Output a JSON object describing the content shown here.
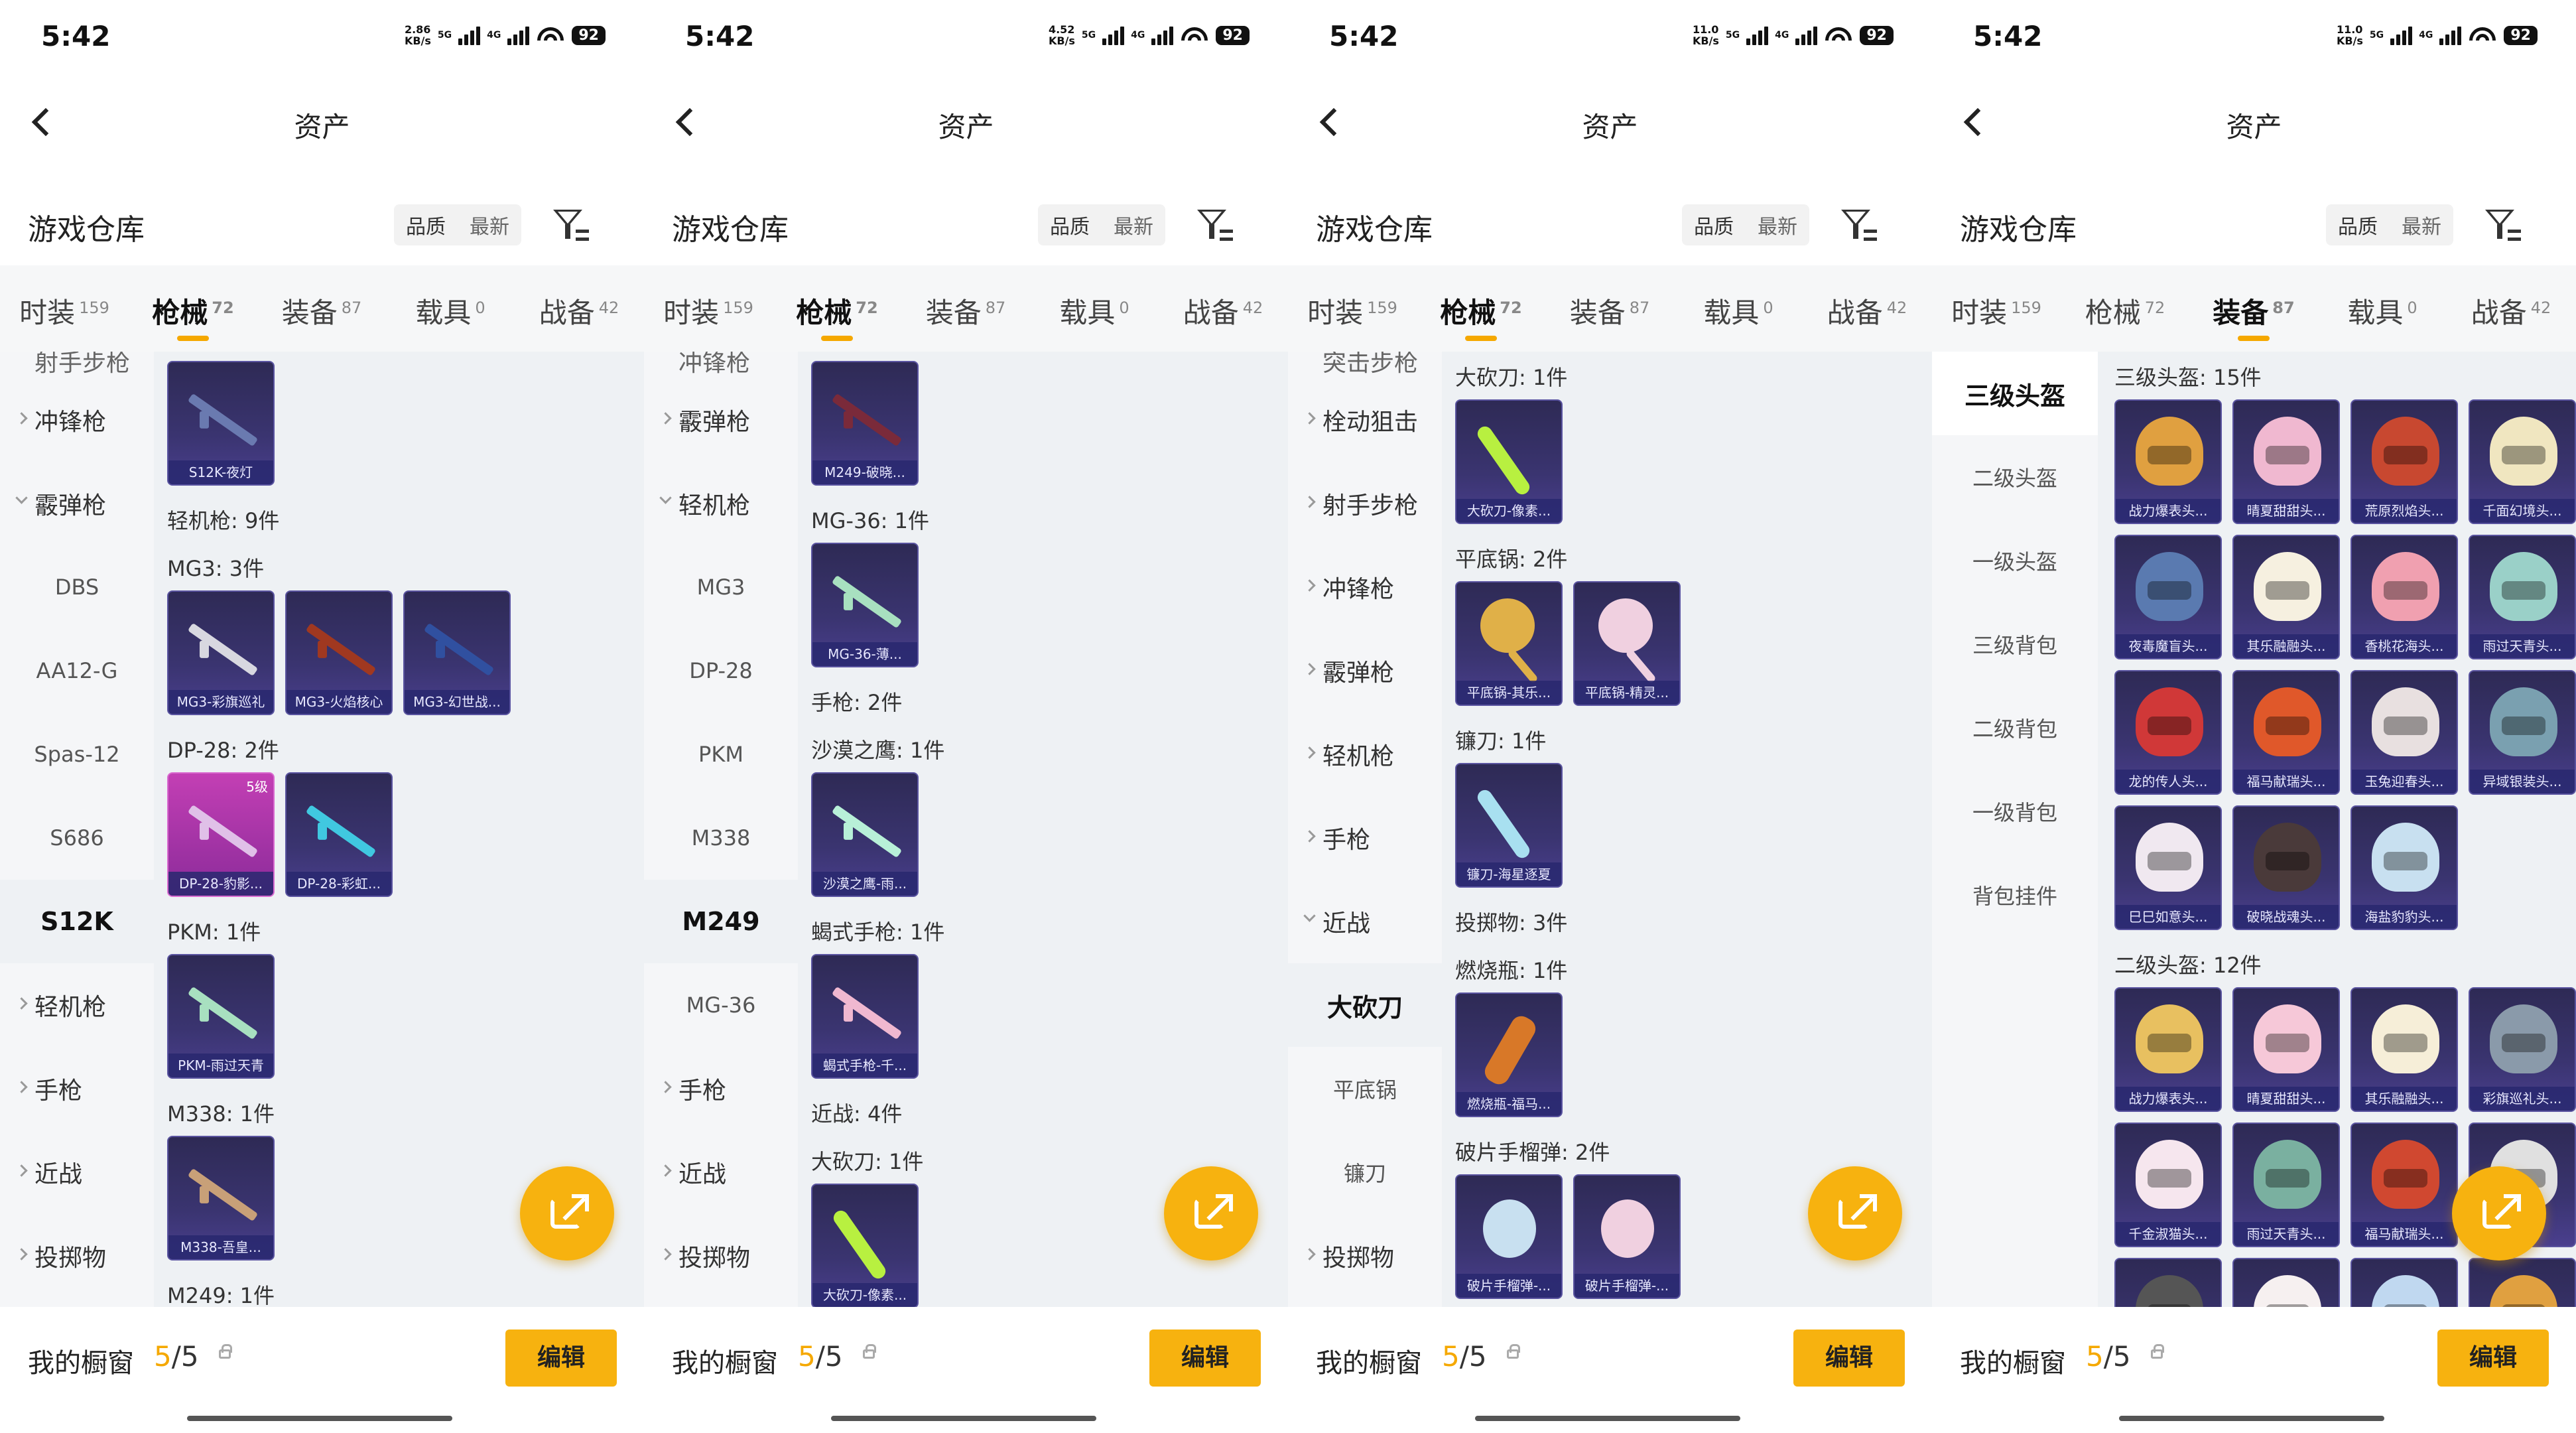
{
  "panels": [
    {
      "status": {
        "time": "5:42",
        "speed": "2.86",
        "speed_unit": "KB/s",
        "net": "5G",
        "net2": "4G",
        "battery": "92"
      },
      "nav": {
        "title": "资产"
      },
      "header": {
        "title": "游戏仓库",
        "sort1": "品质",
        "sort2": "最新"
      },
      "tabs": [
        {
          "label": "时装",
          "count": "159"
        },
        {
          "label": "枪械",
          "count": "72"
        },
        {
          "label": "装备",
          "count": "87"
        },
        {
          "label": "载具",
          "count": "0"
        },
        {
          "label": "战备",
          "count": "42"
        }
      ],
      "side": [
        "射手步枪",
        "冲锋枪",
        "霰弹枪",
        "DBS",
        "AA12-G",
        "Spas-12",
        "S686",
        "S12K",
        "轻机枪",
        "手枪",
        "近战",
        "投掷物"
      ],
      "sections": [
        {
          "title": "",
          "items": [
            {
              "name": "S12K-夜灯"
            }
          ]
        },
        {
          "title": "轻机枪: 9件",
          "items": []
        },
        {
          "title": "MG3: 3件",
          "items": [
            {
              "name": "MG3-彩旗巡礼"
            },
            {
              "name": "MG3-火焰核心"
            },
            {
              "name": "MG3-幻世战..."
            }
          ]
        },
        {
          "title": "DP-28: 2件",
          "items": [
            {
              "name": "DP-28-豹影...",
              "badge": "5级"
            },
            {
              "name": "DP-28-彩虹..."
            }
          ]
        },
        {
          "title": "PKM: 1件",
          "items": [
            {
              "name": "PKM-雨过天青"
            }
          ]
        },
        {
          "title": "M338: 1件",
          "items": [
            {
              "name": "M338-吾皇..."
            }
          ]
        },
        {
          "title": "M249: 1件",
          "items": []
        }
      ],
      "footer": {
        "title": "我的橱窗",
        "count_hl": "5",
        "count_rest": "/5",
        "edit": "编辑"
      }
    },
    {
      "status": {
        "time": "5:42",
        "speed": "4.52",
        "speed_unit": "KB/s",
        "net": "5G",
        "net2": "4G",
        "battery": "92"
      },
      "nav": {
        "title": "资产"
      },
      "header": {
        "title": "游戏仓库",
        "sort1": "品质",
        "sort2": "最新"
      },
      "tabs": [
        {
          "label": "时装",
          "count": "159"
        },
        {
          "label": "枪械",
          "count": "72"
        },
        {
          "label": "装备",
          "count": "87"
        },
        {
          "label": "载具",
          "count": "0"
        },
        {
          "label": "战备",
          "count": "42"
        }
      ],
      "side": [
        "冲锋枪",
        "霰弹枪",
        "轻机枪",
        "MG3",
        "DP-28",
        "PKM",
        "M338",
        "M249",
        "MG-36",
        "手枪",
        "近战",
        "投掷物"
      ],
      "sections": [
        {
          "title": "",
          "items": [
            {
              "name": "M249-破晓..."
            }
          ]
        },
        {
          "title": "MG-36: 1件",
          "items": [
            {
              "name": "MG-36-薄..."
            }
          ]
        },
        {
          "title": "手枪: 2件",
          "items": []
        },
        {
          "title": "沙漠之鹰: 1件",
          "items": [
            {
              "name": "沙漠之鹰-雨..."
            }
          ]
        },
        {
          "title": "蝎式手枪: 1件",
          "items": [
            {
              "name": "蝎式手枪-千..."
            }
          ]
        },
        {
          "title": "近战: 4件",
          "items": []
        },
        {
          "title": "大砍刀: 1件",
          "items": [
            {
              "name": "大砍刀-像素..."
            }
          ]
        }
      ],
      "footer": {
        "title": "我的橱窗",
        "count_hl": "5",
        "count_rest": "/5",
        "edit": "编辑"
      }
    },
    {
      "status": {
        "time": "5:42",
        "speed": "11.0",
        "speed_unit": "KB/s",
        "net": "5G",
        "net2": "4G",
        "battery": "92"
      },
      "nav": {
        "title": "资产"
      },
      "header": {
        "title": "游戏仓库",
        "sort1": "品质",
        "sort2": "最新"
      },
      "tabs": [
        {
          "label": "时装",
          "count": "159"
        },
        {
          "label": "枪械",
          "count": "72"
        },
        {
          "label": "装备",
          "count": "87"
        },
        {
          "label": "载具",
          "count": "0"
        },
        {
          "label": "战备",
          "count": "42"
        }
      ],
      "side": [
        "突击步枪",
        "栓动狙击",
        "射手步枪",
        "冲锋枪",
        "霰弹枪",
        "轻机枪",
        "手枪",
        "近战",
        "大砍刀",
        "平底锅",
        "镰刀",
        "投掷物"
      ],
      "sections": [
        {
          "title": "大砍刀: 1件",
          "items": [
            {
              "name": "大砍刀-像素..."
            }
          ]
        },
        {
          "title": "平底锅: 2件",
          "items": [
            {
              "name": "平底锅-其乐..."
            },
            {
              "name": "平底锅-精灵..."
            }
          ]
        },
        {
          "title": "镰刀: 1件",
          "items": [
            {
              "name": "镰刀-海星逐夏"
            }
          ]
        },
        {
          "title": "投掷物: 3件",
          "items": []
        },
        {
          "title": "燃烧瓶: 1件",
          "items": [
            {
              "name": "燃烧瓶-福马..."
            }
          ]
        },
        {
          "title": "破片手榴弹: 2件",
          "items": [
            {
              "name": "破片手榴弹-..."
            },
            {
              "name": "破片手榴弹-..."
            }
          ]
        }
      ],
      "footer": {
        "title": "我的橱窗",
        "count_hl": "5",
        "count_rest": "/5",
        "edit": "编辑"
      }
    },
    {
      "status": {
        "time": "5:42",
        "speed": "11.0",
        "speed_unit": "KB/s",
        "net": "5G",
        "net2": "4G",
        "battery": "92"
      },
      "nav": {
        "title": "资产"
      },
      "header": {
        "title": "游戏仓库",
        "sort1": "品质",
        "sort2": "最新"
      },
      "tabs": [
        {
          "label": "时装",
          "count": "159"
        },
        {
          "label": "枪械",
          "count": "72"
        },
        {
          "label": "装备",
          "count": "87"
        },
        {
          "label": "载具",
          "count": "0"
        },
        {
          "label": "战备",
          "count": "42"
        }
      ],
      "side": [
        "三级头盔",
        "二级头盔",
        "一级头盔",
        "三级背包",
        "二级背包",
        "一级背包",
        "背包挂件"
      ],
      "sections": [
        {
          "title": "三级头盔: 15件",
          "items": [
            {
              "name": "战力爆表头..."
            },
            {
              "name": "晴夏甜甜头..."
            },
            {
              "name": "荒原烈焰头..."
            },
            {
              "name": "千面幻境头..."
            },
            {
              "name": "夜毒魔盲头..."
            },
            {
              "name": "其乐融融头..."
            },
            {
              "name": "香桃花海头..."
            },
            {
              "name": "雨过天青头..."
            },
            {
              "name": "龙的传人头..."
            },
            {
              "name": "福马献瑞头..."
            },
            {
              "name": "玉兔迎春头..."
            },
            {
              "name": "异域银装头..."
            },
            {
              "name": "巳巳如意头..."
            },
            {
              "name": "破晓战魂头..."
            },
            {
              "name": "海盐豹豹头..."
            }
          ]
        },
        {
          "title": "二级头盔: 12件",
          "items": [
            {
              "name": "战力爆表头..."
            },
            {
              "name": "晴夏甜甜头..."
            },
            {
              "name": "其乐融融头..."
            },
            {
              "name": "彩旗巡礼头..."
            },
            {
              "name": "千金淑猫头..."
            },
            {
              "name": "雨过天青头..."
            },
            {
              "name": "福马献瑞头..."
            },
            {
              "name": ""
            },
            {
              "name": ""
            },
            {
              "name": ""
            },
            {
              "name": ""
            },
            {
              "name": ""
            }
          ]
        }
      ],
      "footer": {
        "title": "我的橱窗",
        "count_hl": "5",
        "count_rest": "/5",
        "edit": "编辑"
      }
    }
  ],
  "colors": {
    "accent": "#f5a800",
    "fab": "#f7b20f",
    "card": "#3a3470",
    "card_pink": "#c33fb4"
  }
}
